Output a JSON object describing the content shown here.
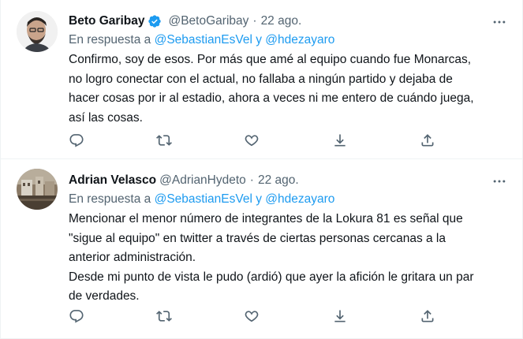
{
  "tweets": [
    {
      "name": "Beto Garibay",
      "verified": true,
      "handle": "@BetoGaribay",
      "date": "22 ago.",
      "reply_prefix": "En respuesta a",
      "reply_mentions": "@SebastianEsVel y @hdezayaro",
      "lines": [
        "Confirmo, soy de esos. Por más que amé al equipo cuando fue Monarcas,",
        "no logro conectar con el actual, no fallaba a ningún partido y dejaba de",
        "hacer cosas por ir al estadio, ahora a veces ni me entero de cuándo juega,",
        "así las cosas."
      ]
    },
    {
      "name": "Adrian Velasco",
      "verified": false,
      "handle": "@AdrianHydeto",
      "date": "22 ago.",
      "reply_prefix": "En respuesta a",
      "reply_mentions": "@SebastianEsVel y @hdezayaro",
      "lines": [
        "Mencionar el menor número de integrantes de la Lokura 81 es señal que",
        "\"sigue al equipo\" en twitter a través de ciertas personas cercanas a la",
        "anterior administración.",
        "Desde mi punto de vista le pudo (ardió) que ayer la afición le gritara un par",
        "de verdades."
      ]
    }
  ],
  "separator": "·",
  "icons": [
    "more-icon",
    "reply-icon",
    "retweet-icon",
    "like-icon",
    "download-icon",
    "share-icon"
  ],
  "colors": {
    "link": "#1d9bf0",
    "muted": "#536471",
    "text": "#0f1419",
    "border": "#eff3f4"
  }
}
